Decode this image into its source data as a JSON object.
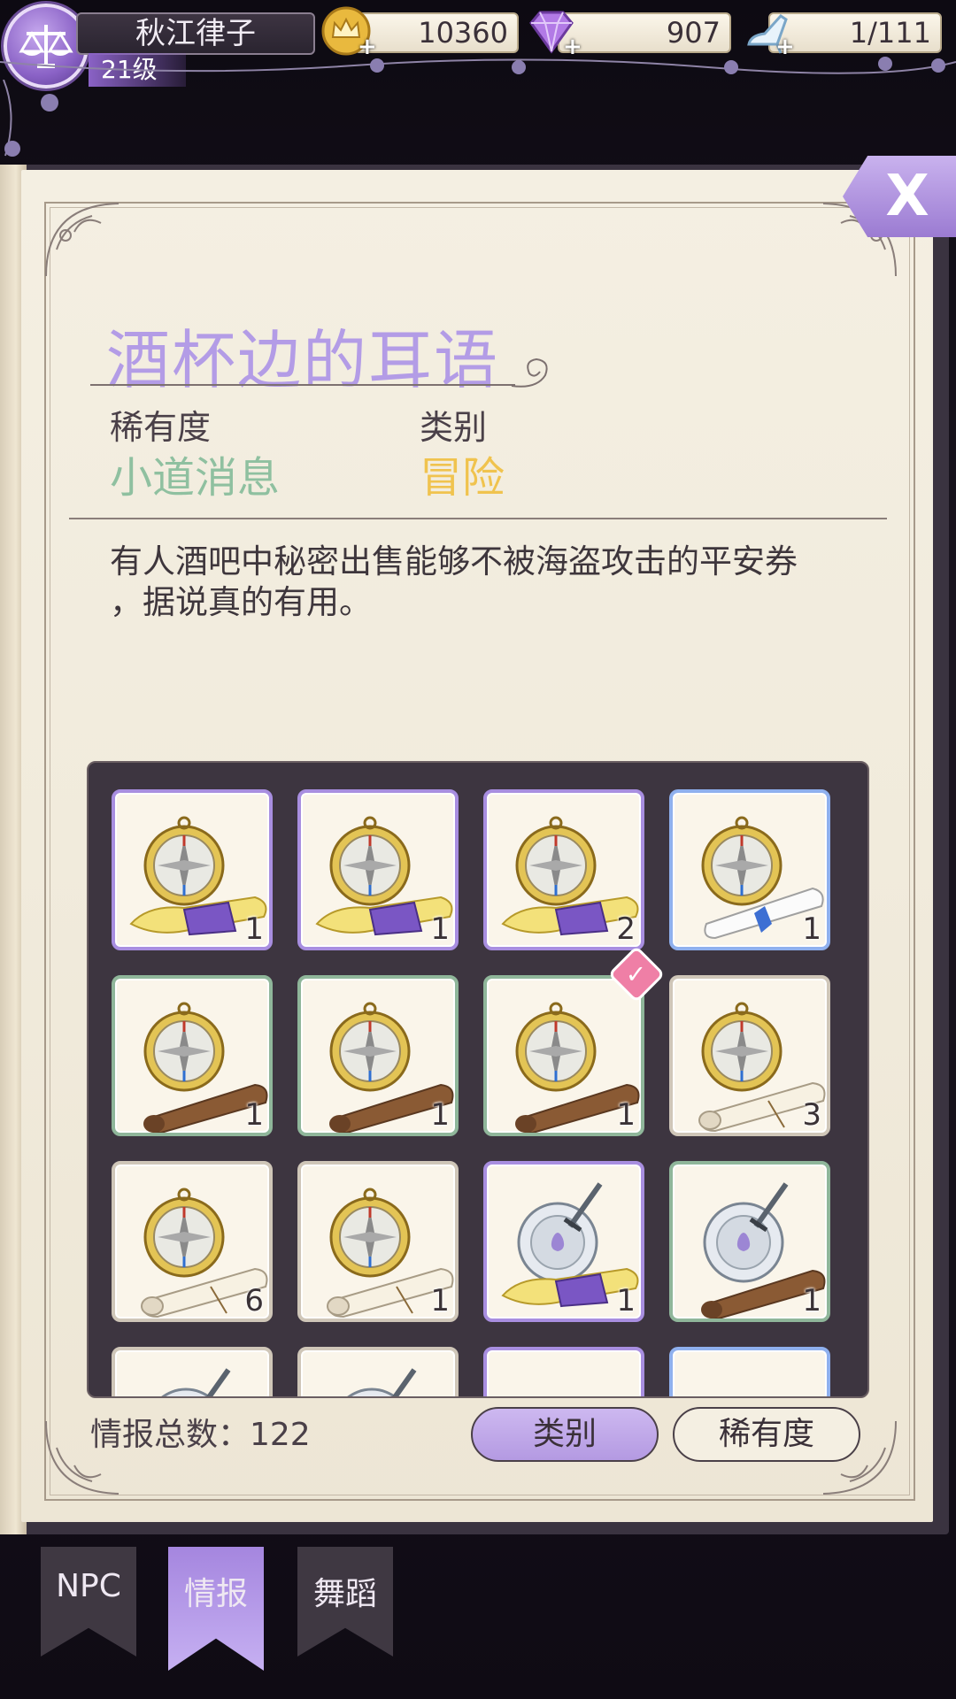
{
  "player": {
    "name": "秋江律子",
    "level": "21级"
  },
  "resources": {
    "gold": "10360",
    "gems": "907",
    "stamina": "1/111"
  },
  "close": {
    "label": "X"
  },
  "info": {
    "title": "酒杯边的耳语",
    "rarity_label": "稀有度",
    "rarity_value": "小道消息",
    "category_label": "类别",
    "category_value": "冒险",
    "description_line1": "有人酒吧中秘密出售能够不被海盗攻击的平安券",
    "description_line2": "，据说真的有用。"
  },
  "grid": {
    "items": [
      {
        "count": "1",
        "rarity": "purple",
        "icon": "compass-purple-scroll-icon"
      },
      {
        "count": "1",
        "rarity": "purple",
        "icon": "compass-purple-scroll-icon"
      },
      {
        "count": "2",
        "rarity": "purple",
        "icon": "compass-purple-scroll-icon"
      },
      {
        "count": "1",
        "rarity": "blue",
        "icon": "compass-blue-scroll-icon"
      },
      {
        "count": "1",
        "rarity": "green",
        "icon": "compass-brown-scroll-icon"
      },
      {
        "count": "1",
        "rarity": "green",
        "icon": "compass-brown-scroll-icon"
      },
      {
        "count": "1",
        "rarity": "green",
        "icon": "compass-brown-scroll-icon",
        "selected": true
      },
      {
        "count": "3",
        "rarity": "white",
        "icon": "compass-white-scroll-icon"
      },
      {
        "count": "6",
        "rarity": "white",
        "icon": "compass-white-scroll-icon"
      },
      {
        "count": "1",
        "rarity": "white",
        "icon": "compass-white-scroll-icon"
      },
      {
        "count": "1",
        "rarity": "purple",
        "icon": "shield-sword-purple-scroll-icon"
      },
      {
        "count": "1",
        "rarity": "green",
        "icon": "shield-sword-brown-scroll-icon"
      },
      {
        "count": "",
        "rarity": "white",
        "icon": "shield-sword-icon"
      },
      {
        "count": "",
        "rarity": "white",
        "icon": "shield-sword-icon"
      },
      {
        "count": "",
        "rarity": "purple",
        "icon": "bird-icon"
      },
      {
        "count": "",
        "rarity": "blue",
        "icon": "bird-icon"
      }
    ]
  },
  "footer": {
    "total_label": "情报总数：122",
    "category_button": "类别",
    "rarity_button": "稀有度"
  },
  "tabs": [
    {
      "label": "NPC",
      "active": false
    },
    {
      "label": "情报",
      "active": true
    },
    {
      "label": "舞蹈",
      "active": false
    }
  ],
  "colors": {
    "accent_purple": "#b39ce6",
    "rarity_green": "#8fc0a0",
    "category_gold": "#f0c34e"
  }
}
